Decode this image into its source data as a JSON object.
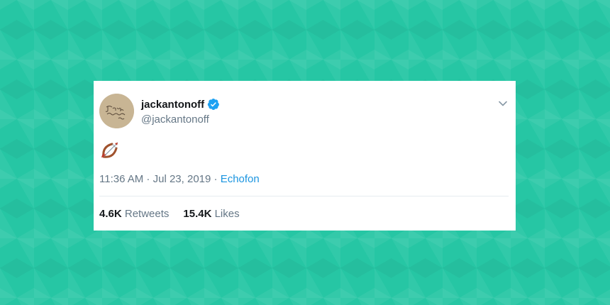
{
  "tweet": {
    "display_name": "jackantonoff",
    "handle": "@jackantonoff",
    "verified": true,
    "body_emoji": "bow-and-arrow",
    "time": "11:36 AM",
    "separator": " · ",
    "date": "Jul 23, 2019",
    "source": "Echofon",
    "retweets_count": "4.6K",
    "retweets_label": "Retweets",
    "likes_count": "15.4K",
    "likes_label": "Likes"
  },
  "colors": {
    "background": "#26c6a4",
    "card": "#ffffff",
    "link": "#1b95e0",
    "verified": "#1da1f2",
    "muted": "#657786"
  }
}
